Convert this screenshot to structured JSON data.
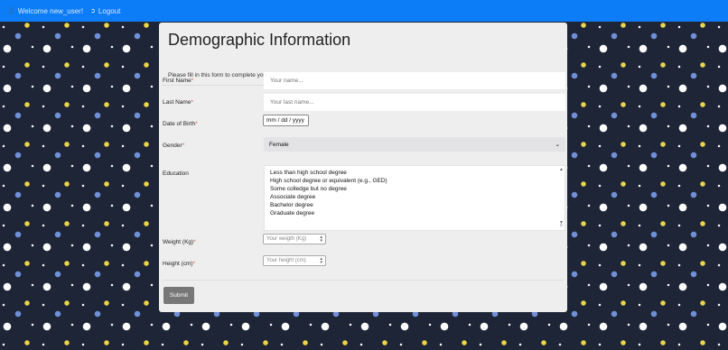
{
  "topbar": {
    "welcome": "Welcome new_user!",
    "logout": "Logout",
    "user_icon": "user-icon",
    "logout_icon": "sign-out-icon",
    "color": "#0d7cf7"
  },
  "form": {
    "title": "Demographic Information",
    "subtitle": "Please fill in this form to complete your account.",
    "first_name": {
      "label": "First Name",
      "placeholder": "Your name..."
    },
    "last_name": {
      "label": "Last Name",
      "placeholder": "Your last name..."
    },
    "dob": {
      "label": "Date of Birth",
      "value": "mm / dd / yyyy"
    },
    "gender": {
      "label": "Gender",
      "value": "Female"
    },
    "education": {
      "label": "Education",
      "options": [
        "Less than high school degree",
        "High school degree or equivalent (e.g., GED)",
        "Some colledge but no degree",
        "Associate degree",
        "Bachelor degree",
        "Graduate degree"
      ]
    },
    "weight": {
      "label": "Weight (Kg)",
      "placeholder": "Your weigth (Kg)"
    },
    "height": {
      "label": "Height (cm)",
      "placeholder": "Your height (cm)"
    },
    "required_mark": "*",
    "submit": "Submit"
  }
}
